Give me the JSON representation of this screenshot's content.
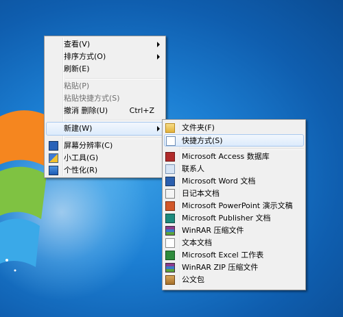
{
  "context_menu": {
    "items": [
      {
        "label": "查看(V)",
        "submenu": true
      },
      {
        "label": "排序方式(O)",
        "submenu": true
      },
      {
        "label": "刷新(E)"
      },
      {
        "label": "粘贴(P)",
        "disabled": true
      },
      {
        "label": "粘贴快捷方式(S)",
        "disabled": true
      },
      {
        "label": "撤消 删除(U)",
        "shortcut": "Ctrl+Z"
      },
      {
        "label": "新建(W)",
        "submenu": true,
        "highlighted": true
      },
      {
        "label": "屏幕分辨率(C)",
        "icon": "screen-resolution-icon"
      },
      {
        "label": "小工具(G)",
        "icon": "gadgets-icon"
      },
      {
        "label": "个性化(R)",
        "icon": "personalize-icon"
      }
    ]
  },
  "new_submenu": {
    "items": [
      {
        "label": "文件夹(F)",
        "icon": "folder-icon"
      },
      {
        "label": "快捷方式(S)",
        "icon": "shortcut-icon"
      },
      {
        "label": "Microsoft Access 数据库",
        "icon": "access-icon"
      },
      {
        "label": "联系人",
        "icon": "contact-icon"
      },
      {
        "label": "Microsoft Word 文档",
        "icon": "word-icon"
      },
      {
        "label": "日记本文档",
        "icon": "journal-icon"
      },
      {
        "label": "Microsoft PowerPoint 演示文稿",
        "icon": "powerpoint-icon"
      },
      {
        "label": "Microsoft Publisher 文档",
        "icon": "publisher-icon"
      },
      {
        "label": "WinRAR 压缩文件",
        "icon": "winrar-icon"
      },
      {
        "label": "文本文档",
        "icon": "text-document-icon"
      },
      {
        "label": "Microsoft Excel 工作表",
        "icon": "excel-icon"
      },
      {
        "label": "WinRAR ZIP 压缩文件",
        "icon": "winrar-zip-icon"
      },
      {
        "label": "公文包",
        "icon": "briefcase-icon"
      }
    ]
  },
  "colors": {
    "desktop": "#1c7fd3",
    "menu_bg": "#f0f0f0",
    "highlight_border": "#a9c9ef"
  }
}
